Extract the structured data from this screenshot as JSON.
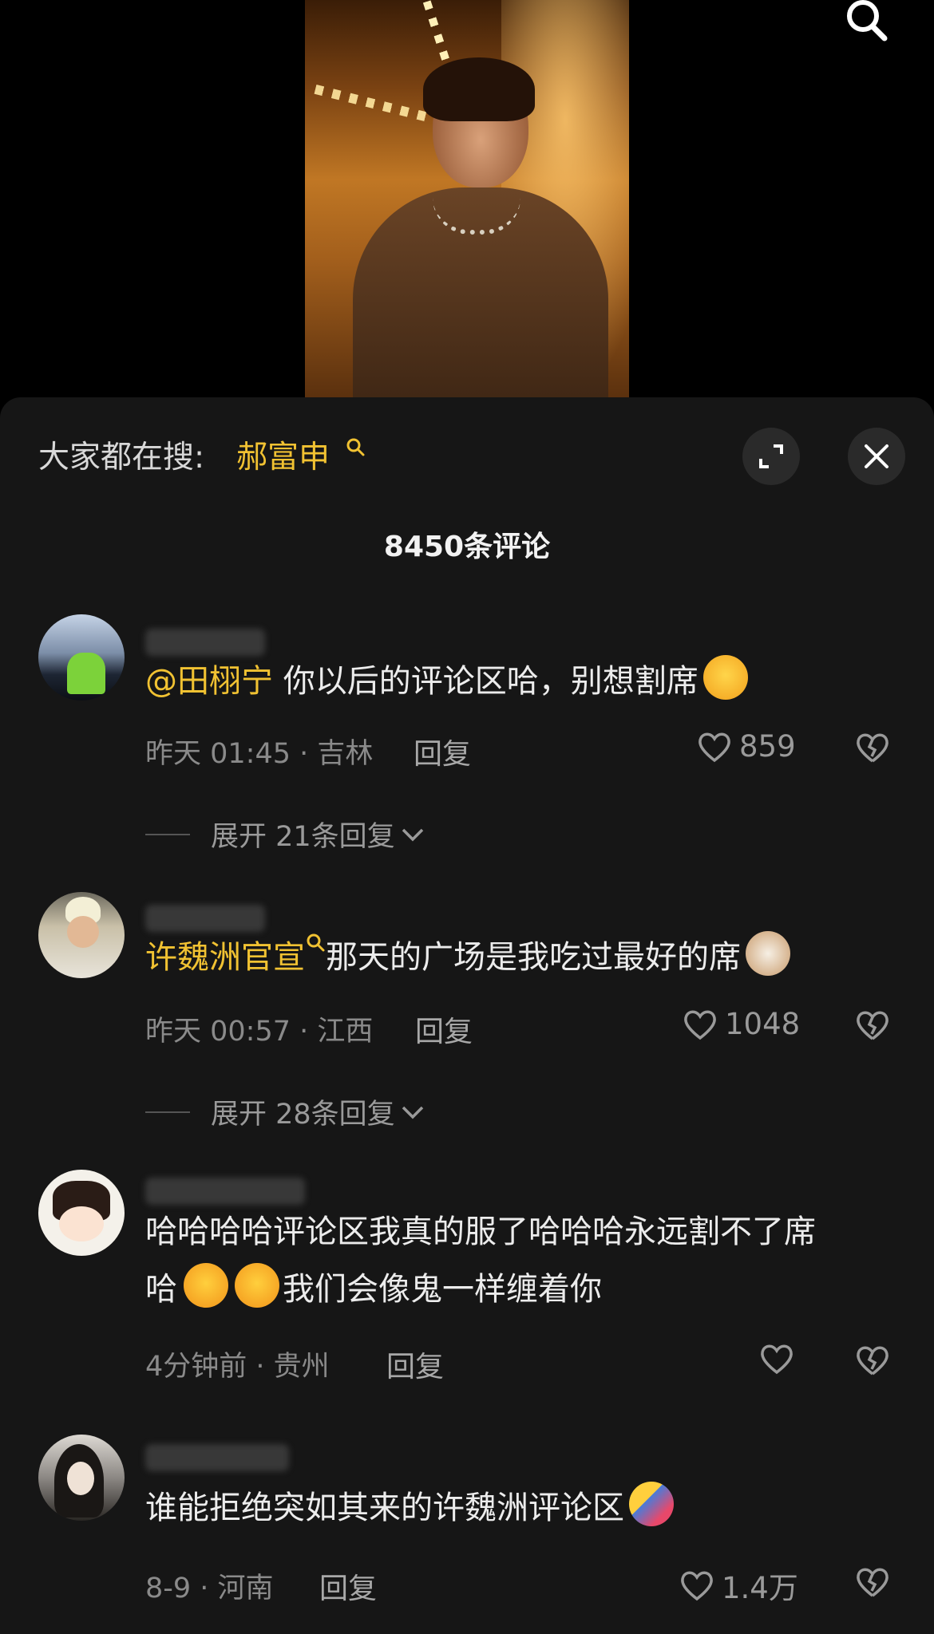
{
  "video": {
    "description_icon": "search-icon"
  },
  "sheet": {
    "trending_label": "大家都在搜:",
    "trending_term": "郝富申",
    "comment_count": "8450条评论"
  },
  "comments": [
    {
      "mention": "@田栩宁",
      "text": " 你以后的评论区哈，别想割席",
      "time_location": "昨天 01:45 · 吉林",
      "reply_label": "回复",
      "likes": "859",
      "expand_label": "展开 21条回复"
    },
    {
      "mention": "许魏洲官宣",
      "text": "那天的广场是我吃过最好的席",
      "time_location": "昨天 00:57 · 江西",
      "reply_label": "回复",
      "likes": "1048",
      "expand_label": "展开 28条回复"
    },
    {
      "text_line1": "哈哈哈哈评论区我真的服了哈哈哈永远割不了席",
      "text_line2a": "哈",
      "text_line2b": "我们会像鬼一样缠着你",
      "time_location": "4分钟前 · 贵州",
      "reply_label": "回复"
    },
    {
      "text": "谁能拒绝突如其来的许魏洲评论区",
      "time_location": "8-9 · 河南",
      "reply_label": "回复",
      "likes": "1.4万"
    }
  ],
  "colors": {
    "accent": "#f1c232",
    "sheet_bg": "#161616"
  }
}
